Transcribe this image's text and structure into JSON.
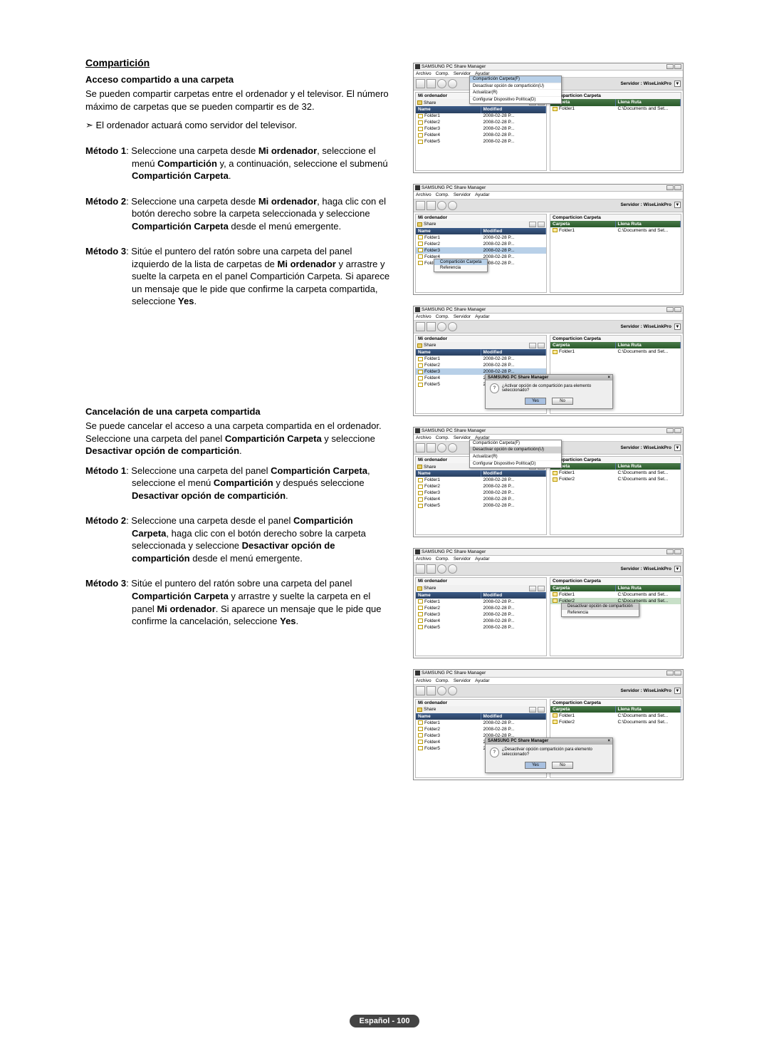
{
  "doc": {
    "section1_title": "Compartición",
    "section1_subtitle": "Acceso compartido a una carpeta",
    "section1_para": "Se pueden compartir carpetas entre el ordenador y el televisor. El número máximo de carpetas que se pueden compartir es de 32.",
    "section1_note": "El ordenador actuará como servidor del televisor.",
    "m1_label": "Método 1",
    "m1_text": ": Seleccione una carpeta desde Mi ordenador, seleccione el menú Compartición y, a continuación, seleccione el submenú Compartición Carpeta.",
    "m2_label": "Método 2",
    "m2_text": ": Seleccione una carpeta desde Mi ordenador, haga clic con el botón derecho sobre la carpeta seleccionada y seleccione Compartición Carpeta desde el menú emergente.",
    "m3_label": "Método 3",
    "m3_text": ": Sitúe el puntero del ratón sobre una carpeta del panel izquierdo de la lista de carpetas de Mi ordenador y arrastre y suelte la carpeta en el panel Compartición Carpeta. Si aparece un mensaje que le pide que confirme la carpeta compartida, seleccione Yes.",
    "section2_title": "Cancelación de una carpeta compartida",
    "section2_para": "Se puede cancelar el acceso a una carpeta compartida en el ordenador. Seleccione una carpeta del panel Compartición Carpeta y seleccione Desactivar opción de compartición.",
    "c1_label": "Método 1",
    "c1_text": ": Seleccione una carpeta del panel Compartición Carpeta, seleccione el menú Compartición y después seleccione Desactivar opción de compartición.",
    "c2_label": "Método 2",
    "c2_text": ": Seleccione una carpeta desde el panel Compartición Carpeta, haga clic con el botón derecho sobre la carpeta seleccionada y seleccione Desactivar opción de compartición desde el menú emergente.",
    "c3_label": "Método 3",
    "c3_text": ": Sitúe el puntero del ratón sobre una carpeta del panel Compartición Carpeta y arrastre y suelte la carpeta en el panel Mi ordenador. Si aparece un mensaje que le pide que confirme la cancelación, seleccione Yes."
  },
  "app": {
    "title": "SAMSUNG PC Share Manager",
    "menu": {
      "archivo": "Archivo",
      "comp": "Comp.",
      "servidor": "Servidor",
      "ayudar": "Ayudar"
    },
    "server_label": "Servidor :",
    "server": "WiseLinkPro",
    "left_pane_title": "Mi ordenador",
    "right_pane_title": "Comparticion Carpeta",
    "path": "Share",
    "cols_left": {
      "name": "Name",
      "modified": "Modified"
    },
    "cols_right": {
      "carpeta": "Carpeta",
      "ruta": "Llena Ruta"
    },
    "folders": [
      {
        "name": "Folder1",
        "modified": "2008-02-28 P..."
      },
      {
        "name": "Folder2",
        "modified": "2008-02-28 P..."
      },
      {
        "name": "Folder3",
        "modified": "2008-02-28 P..."
      },
      {
        "name": "Folder4",
        "modified": "2008-02-28 P..."
      },
      {
        "name": "Folder5",
        "modified": "2008-02-28 P..."
      }
    ],
    "shared1": {
      "name": "Folder1",
      "path": "C:\\Documents and Set..."
    },
    "shared2": {
      "name": "Folder2",
      "path": "C:\\Documents and Set..."
    },
    "dropdown": {
      "item1": "Compartición Carpeta(F)",
      "item2": "Desactivar opción de compartición(U)",
      "item3": "Actualizar(R)",
      "item4": "Configurar Dispositivo Política(D)"
    },
    "ctx": {
      "item1": "Compartición Carpeta",
      "item2": "Referencia"
    },
    "ctx2": {
      "item1": "Desactivar opción de compartición",
      "item2": "Referencia"
    },
    "msg": {
      "title": "SAMSUNG PC Share Manager",
      "q1": "¿Activar opción de compartición para elemento seleccionado?",
      "q2": "¿Desactivar opción compartición para elemento seleccionado?",
      "yes": "Yes",
      "no": "No"
    }
  },
  "footer": "Español - 100"
}
